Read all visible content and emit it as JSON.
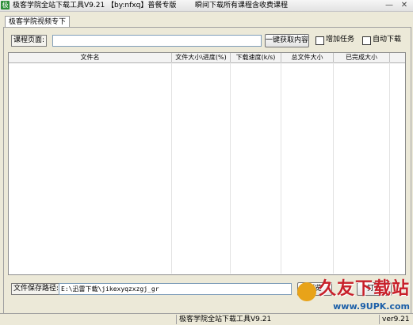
{
  "window": {
    "title": "极客学院全站下载工具V9.21",
    "author": "【by:nfxq】普餐专版",
    "slogan": "瞬间下载所有课程含收费课程",
    "icon_label": "极"
  },
  "tabs": [
    {
      "label": "极客学院视频专下"
    }
  ],
  "course": {
    "label": "课程页面:",
    "value": "",
    "fetch_button": "一键获取内容",
    "add_task_label": "增加任务",
    "add_task_checked": false,
    "auto_download_label": "自动下载",
    "auto_download_checked": false
  },
  "table": {
    "columns": [
      "文件名",
      "文件大小\\进度(%)",
      "下载速度(k/s)",
      "总文件大小",
      "已完成大小"
    ],
    "rows": []
  },
  "save": {
    "label": "文件保存路径:",
    "path": "E:\\迅雷下载\\jikexyqzxzgj_gr",
    "browse_button": "浏览",
    "open_button": "打开"
  },
  "status": {
    "text": "极客学院全站下载工具V9.21",
    "version": "ver9.21"
  },
  "watermark": {
    "brand": "久友下载站",
    "url": "www.9UPK.com"
  }
}
